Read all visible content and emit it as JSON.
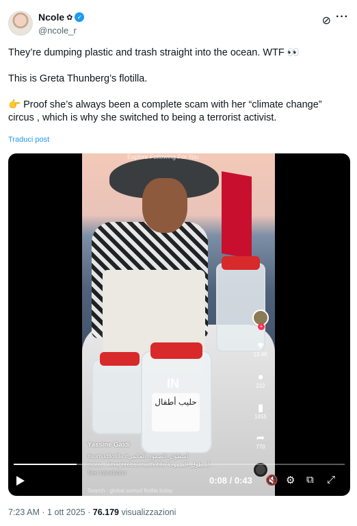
{
  "author": {
    "display_name": "Ncole",
    "badge_glyph": "✿",
    "handle": "@ncole_r",
    "verified": true,
    "verified_color": "#1d9bf0"
  },
  "header_icons": {
    "grok": "grok-icon",
    "more": "more-options-icon",
    "more_glyph": "···",
    "grok_glyph": "⊘"
  },
  "tweet": {
    "paragraphs": [
      "They’re dumping plastic and trash straight into the ocean. WTF 👀",
      "This is Greta Thunberg’s flotilla.",
      "👉 Proof she’s always been a complete scam with her “climate change” circus , which is why she switched to being a terrorist activist."
    ],
    "translate_label": "Traduci post"
  },
  "video": {
    "tiktok": {
      "top_nav": "Explore   Following   For You",
      "watermark": "IN",
      "username": "Yassine Gaidi",
      "caption_line1": "#sumudflotilla #أسطول_الصمود_العالمي",
      "caption_line2": "more... #maghrebsumudflotilla #أسطول_الصمود",
      "see_translation": "See translation",
      "search": "Search · global sumud flotilla today",
      "likes": "13.4K",
      "comments": "222",
      "saves": "1455",
      "shares": "770",
      "jar_label_text": "حليب أطفال"
    },
    "progress_fraction": 0.19,
    "current_time": "0:08",
    "duration": "0:43",
    "time_text": "0:08 / 0:43"
  },
  "meta": {
    "time": "7:23 AM",
    "separator": "·",
    "date": "1 ott 2025",
    "views_count": "76.179",
    "views_label": "visualizzazioni"
  }
}
